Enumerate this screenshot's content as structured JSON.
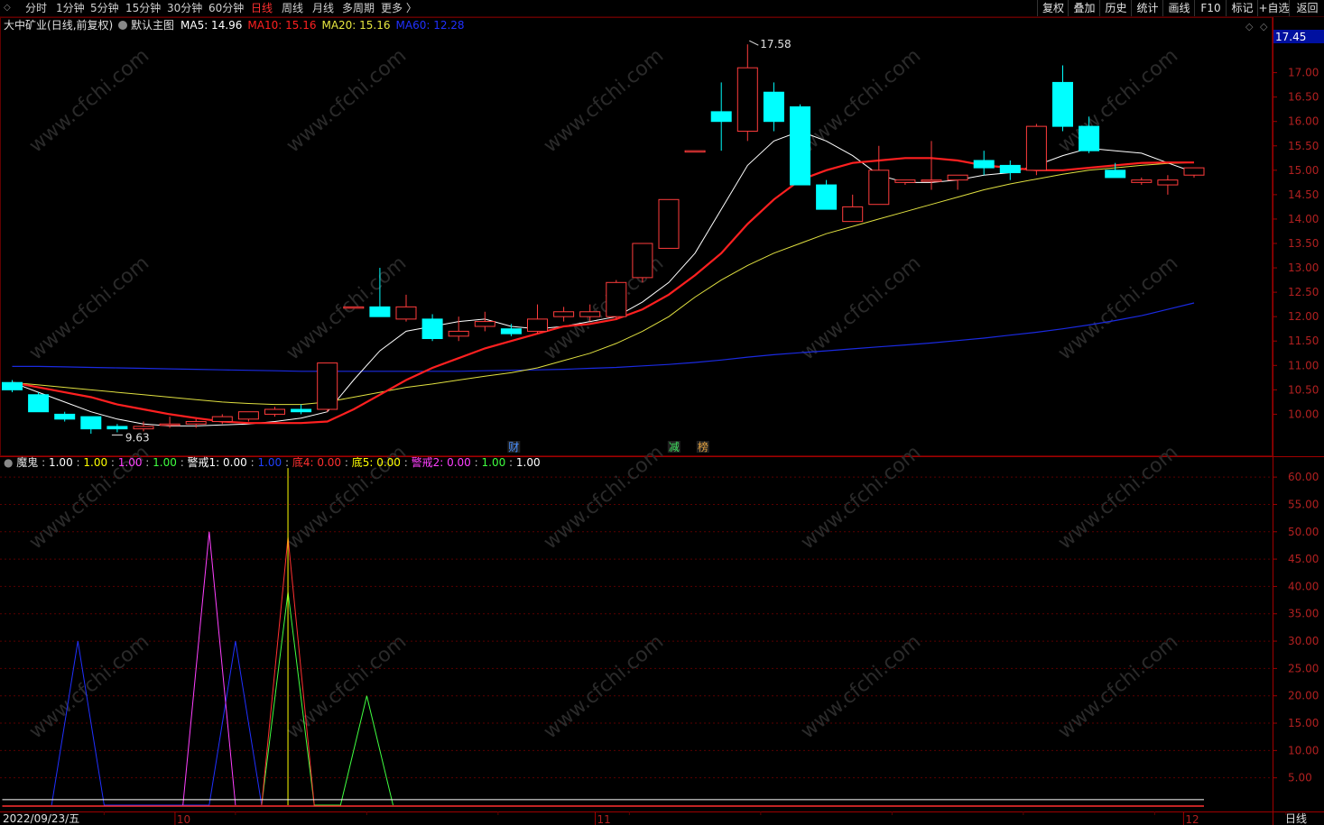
{
  "toolbar": {
    "periods": [
      "分时",
      "1分钟",
      "5分钟",
      "15分钟",
      "30分钟",
      "60分钟",
      "日线",
      "周线",
      "月线",
      "多周期",
      "更多 〉"
    ],
    "active_period": "日线",
    "right_buttons": [
      "复权",
      "叠加",
      "历史",
      "统计",
      "画线",
      "F10",
      "标记",
      "+自选",
      "返回"
    ]
  },
  "main_panel": {
    "stock_name": "大中矿业",
    "mode": "(日线,前复权)",
    "template": "默认主图",
    "ma": [
      {
        "label": "MA5",
        "value": "14.96",
        "color": "#ffffff"
      },
      {
        "label": "MA10",
        "value": "15.16",
        "color": "#ff2020"
      },
      {
        "label": "MA20",
        "value": "15.16",
        "color": "#e8e840"
      },
      {
        "label": "MA60",
        "value": "12.28",
        "color": "#2030ff"
      }
    ],
    "price_tag": "17.45",
    "high_mark": "17.58",
    "low_mark": "9.63",
    "event_tags": [
      {
        "text": "财",
        "color": "#4a90ff"
      },
      {
        "text": "减",
        "color": "#40e060"
      },
      {
        "text": "榜",
        "color": "#e0a040"
      }
    ],
    "y_ticks": [
      "17.00",
      "16.50",
      "16.00",
      "15.50",
      "15.00",
      "14.50",
      "14.00",
      "13.50",
      "13.00",
      "12.50",
      "12.00",
      "11.50",
      "11.00",
      "10.50",
      "10.00"
    ]
  },
  "indicator_panel": {
    "name": "魔鬼",
    "values": [
      {
        "text": "1.00",
        "color": "#ffffff"
      },
      {
        "text": "1.00",
        "color": "#ffff00"
      },
      {
        "text": "1.00",
        "color": "#ff40ff"
      },
      {
        "text": "1.00",
        "color": "#40ff40"
      },
      {
        "text": "警戒1: 0.00",
        "color": "#ffffff"
      },
      {
        "text": "1.00",
        "color": "#2040ff"
      },
      {
        "text": "底4: 0.00",
        "color": "#ff3030"
      },
      {
        "text": "底5: 0.00",
        "color": "#ffff00"
      },
      {
        "text": "警戒2: 0.00",
        "color": "#ff40ff"
      },
      {
        "text": "1.00",
        "color": "#40ff40"
      },
      {
        "text": "1.00",
        "color": "#ffffff"
      }
    ],
    "y_ticks": [
      "60.00",
      "55.00",
      "50.00",
      "45.00",
      "40.00",
      "35.00",
      "30.00",
      "25.00",
      "20.00",
      "15.00",
      "10.00",
      "5.00"
    ]
  },
  "bottom_axis": {
    "date_label": "2022/09/23/五",
    "month_marks": [
      "10",
      "11",
      "12"
    ],
    "period_label": "日线"
  },
  "watermark": "www.cfchi.com",
  "chart_data": {
    "type": "candlestick",
    "ohlc": [
      [
        10.65,
        10.7,
        10.45,
        10.5
      ],
      [
        10.4,
        10.45,
        10.05,
        10.05
      ],
      [
        10.0,
        10.05,
        9.85,
        9.9
      ],
      [
        9.95,
        9.95,
        9.6,
        9.7
      ],
      [
        9.75,
        9.8,
        9.63,
        9.7
      ],
      [
        9.7,
        9.85,
        9.65,
        9.75
      ],
      [
        9.78,
        9.95,
        9.72,
        9.8
      ],
      [
        9.8,
        9.9,
        9.72,
        9.85
      ],
      [
        9.85,
        10.0,
        9.8,
        9.95
      ],
      [
        9.9,
        10.05,
        9.85,
        10.05
      ],
      [
        10.0,
        10.15,
        9.95,
        10.1
      ],
      [
        10.1,
        10.2,
        10.0,
        10.05
      ],
      [
        10.1,
        11.05,
        10.05,
        11.05
      ],
      [
        12.2,
        12.2,
        12.2,
        12.2
      ],
      [
        12.2,
        13.0,
        12.0,
        12.0
      ],
      [
        11.95,
        12.45,
        11.9,
        12.2
      ],
      [
        11.95,
        12.05,
        11.5,
        11.55
      ],
      [
        11.6,
        12.0,
        11.5,
        11.7
      ],
      [
        11.8,
        12.1,
        11.7,
        11.9
      ],
      [
        11.75,
        11.85,
        11.6,
        11.65
      ],
      [
        11.7,
        12.25,
        11.65,
        11.95
      ],
      [
        12.0,
        12.2,
        11.9,
        12.1
      ],
      [
        12.0,
        12.25,
        11.9,
        12.1
      ],
      [
        12.0,
        12.75,
        11.95,
        12.7
      ],
      [
        12.8,
        13.5,
        12.7,
        13.5
      ],
      [
        13.4,
        14.4,
        13.4,
        14.4
      ],
      [
        15.4,
        15.4,
        15.4,
        15.4
      ],
      [
        16.2,
        16.8,
        15.4,
        16.0
      ],
      [
        15.8,
        17.58,
        15.6,
        17.1
      ],
      [
        16.6,
        16.8,
        15.8,
        16.0
      ],
      [
        16.3,
        16.35,
        14.7,
        14.7
      ],
      [
        14.7,
        14.8,
        14.2,
        14.2
      ],
      [
        13.95,
        14.5,
        13.95,
        14.25
      ],
      [
        14.3,
        15.5,
        14.3,
        15.0
      ],
      [
        14.75,
        14.8,
        14.7,
        14.8
      ],
      [
        14.8,
        15.6,
        14.6,
        14.8
      ],
      [
        14.8,
        14.9,
        14.6,
        14.9
      ],
      [
        15.2,
        15.4,
        14.9,
        15.05
      ],
      [
        15.1,
        15.2,
        14.8,
        14.95
      ],
      [
        15.0,
        15.95,
        14.9,
        15.9
      ],
      [
        16.8,
        17.15,
        15.8,
        15.9
      ],
      [
        15.9,
        16.1,
        15.35,
        15.4
      ],
      [
        15.0,
        15.15,
        14.9,
        14.85
      ],
      [
        14.75,
        14.85,
        14.7,
        14.8
      ],
      [
        14.7,
        14.9,
        14.5,
        14.8
      ],
      [
        14.9,
        15.05,
        14.85,
        15.05
      ]
    ],
    "ma5": [
      10.65,
      10.45,
      10.25,
      10.05,
      9.9,
      9.8,
      9.76,
      9.76,
      9.78,
      9.8,
      9.85,
      9.92,
      10.05,
      10.7,
      11.3,
      11.7,
      11.8,
      11.9,
      11.95,
      11.8,
      11.75,
      11.8,
      11.9,
      12.0,
      12.3,
      12.7,
      13.3,
      14.2,
      15.1,
      15.6,
      15.8,
      15.6,
      15.3,
      14.9,
      14.75,
      14.75,
      14.8,
      14.9,
      14.95,
      15.1,
      15.3,
      15.45,
      15.4,
      15.35,
      15.15,
      14.96
    ],
    "ma10": [
      10.65,
      10.55,
      10.45,
      10.35,
      10.2,
      10.1,
      10.0,
      9.92,
      9.85,
      9.82,
      9.82,
      9.82,
      9.85,
      10.1,
      10.4,
      10.7,
      10.95,
      11.15,
      11.35,
      11.5,
      11.65,
      11.8,
      11.85,
      11.95,
      12.15,
      12.45,
      12.85,
      13.3,
      13.9,
      14.4,
      14.8,
      15.0,
      15.15,
      15.2,
      15.25,
      15.25,
      15.2,
      15.1,
      15.05,
      15.0,
      15.0,
      15.05,
      15.1,
      15.15,
      15.16,
      15.16
    ],
    "ma20": [
      10.65,
      10.6,
      10.55,
      10.5,
      10.45,
      10.4,
      10.35,
      10.3,
      10.25,
      10.22,
      10.2,
      10.2,
      10.25,
      10.35,
      10.45,
      10.55,
      10.62,
      10.7,
      10.78,
      10.85,
      10.95,
      11.1,
      11.25,
      11.45,
      11.7,
      12.0,
      12.4,
      12.75,
      13.05,
      13.3,
      13.5,
      13.7,
      13.85,
      14.0,
      14.15,
      14.3,
      14.45,
      14.6,
      14.72,
      14.82,
      14.92,
      15.0,
      15.05,
      15.1,
      15.14,
      15.16
    ],
    "ma60": [
      10.98,
      10.98,
      10.97,
      10.96,
      10.95,
      10.94,
      10.93,
      10.92,
      10.91,
      10.9,
      10.89,
      10.88,
      10.88,
      10.88,
      10.88,
      10.88,
      10.88,
      10.88,
      10.89,
      10.9,
      10.91,
      10.92,
      10.94,
      10.96,
      10.99,
      11.02,
      11.06,
      11.11,
      11.17,
      11.22,
      11.26,
      11.3,
      11.34,
      11.38,
      11.42,
      11.46,
      11.51,
      11.56,
      11.62,
      11.68,
      11.75,
      11.83,
      11.92,
      12.02,
      12.15,
      12.28
    ],
    "indicator": {
      "blue": [
        [
          1,
          0
        ],
        [
          2,
          30
        ],
        [
          3,
          0
        ],
        [
          7,
          0
        ],
        [
          8,
          30
        ],
        [
          9,
          0
        ]
      ],
      "magenta": [
        [
          6,
          0
        ],
        [
          7,
          50
        ],
        [
          8,
          0
        ]
      ],
      "red": [
        [
          9,
          0
        ],
        [
          10,
          49
        ],
        [
          11,
          0
        ]
      ],
      "green": [
        [
          9,
          0
        ],
        [
          10,
          39
        ],
        [
          11,
          0
        ],
        [
          12,
          0
        ],
        [
          13,
          20
        ],
        [
          14,
          0
        ]
      ],
      "yellow_vline": {
        "index": 10,
        "value": 60
      },
      "baseline_values": [
        1,
        0
      ]
    },
    "ylim_price": [
      9.25,
      17.75
    ],
    "ylim_indicator": [
      0,
      62
    ]
  }
}
